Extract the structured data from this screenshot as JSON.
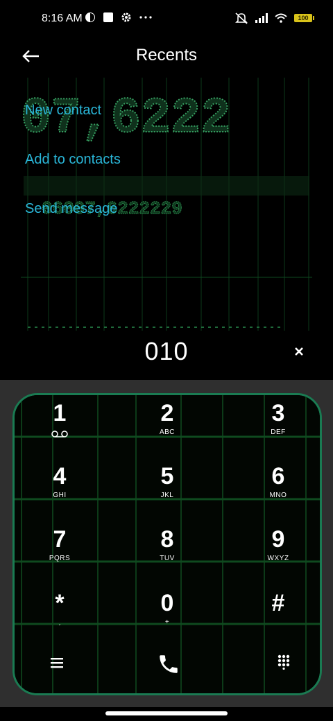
{
  "status_bar": {
    "time": "8:16 AM",
    "battery": "100",
    "left_icons": [
      "moon-timer-icon",
      "square-notification-icon",
      "settings-gear-icon",
      "more-dots-icon"
    ],
    "right_icons": [
      "mute-icon",
      "signal-icon",
      "wifi-icon",
      "battery-icon"
    ]
  },
  "header": {
    "title": "Recents"
  },
  "actions": {
    "new_contact": "New contact",
    "add_to_contacts": "Add to contacts",
    "send_message": "Send message"
  },
  "dialer": {
    "number": "010"
  },
  "keypad": {
    "keys": [
      {
        "digit": "1",
        "sub": ""
      },
      {
        "digit": "2",
        "sub": "ABC"
      },
      {
        "digit": "3",
        "sub": "DEF"
      },
      {
        "digit": "4",
        "sub": "GHI"
      },
      {
        "digit": "5",
        "sub": "JKL"
      },
      {
        "digit": "6",
        "sub": "MNO"
      },
      {
        "digit": "7",
        "sub": "PQRS"
      },
      {
        "digit": "8",
        "sub": "TUV"
      },
      {
        "digit": "9",
        "sub": "WXYZ"
      },
      {
        "digit": "*",
        "sub": "ˏ"
      },
      {
        "digit": "0",
        "sub": "+"
      },
      {
        "digit": "#",
        "sub": ""
      }
    ]
  },
  "bottom_bar": {
    "icons": [
      "menu-icon",
      "call-icon",
      "dialpad-icon"
    ]
  },
  "colors": {
    "accent_link": "#2ab7d9",
    "keypad_border": "#1a7b52",
    "matrix_green": "#3fe07a",
    "battery": "#d8c21a"
  }
}
